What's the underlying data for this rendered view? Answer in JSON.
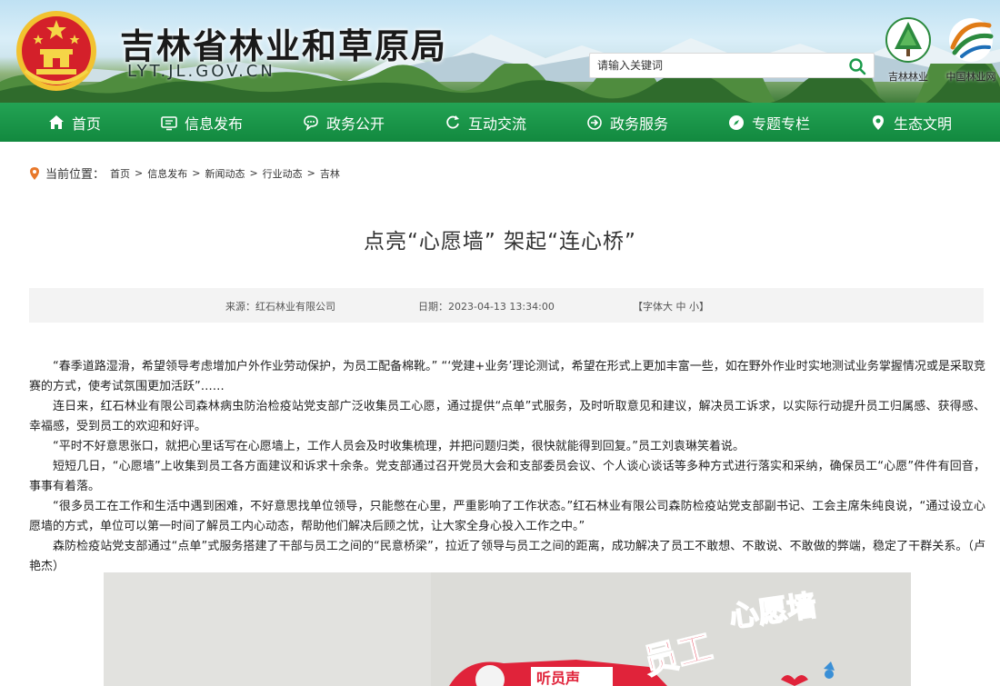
{
  "header": {
    "title": "吉林省林业和草原局",
    "domain": "LYT.JL.GOV.CN",
    "search_placeholder": "请输入关键词",
    "logo1_label": "吉林林业",
    "logo2_label": "中国林业网"
  },
  "nav": {
    "items": [
      {
        "label": "首页",
        "icon": "home-icon"
      },
      {
        "label": "信息发布",
        "icon": "screen-icon"
      },
      {
        "label": "政务公开",
        "icon": "chat-icon"
      },
      {
        "label": "互动交流",
        "icon": "refresh-icon"
      },
      {
        "label": "政务服务",
        "icon": "arrow-circle-icon"
      },
      {
        "label": "专题专栏",
        "icon": "compass-icon"
      },
      {
        "label": "生态文明",
        "icon": "location-icon"
      }
    ]
  },
  "breadcrumb": {
    "label": "当前位置：",
    "items": [
      "首页",
      "信息发布",
      "新闻动态",
      "行业动态",
      "吉林"
    ],
    "separator": ">"
  },
  "article": {
    "title": "点亮“心愿墙” 架起“连心桥”",
    "source_label": "来源：",
    "source": "红石林业有限公司",
    "date_label": "日期：",
    "date": "2023-04-13 13:34:00",
    "font_label": "【字体",
    "font_large": "大",
    "font_medium": "中",
    "font_small": "小",
    "font_close": "】",
    "paragraphs": [
      "“春季道路湿滑，希望领导考虑增加户外作业劳动保护，为员工配备棉靴。” “‘党建+业务’理论测试，希望在形式上更加丰富一些，如在野外作业时实地测试业务掌握情况或是采取竞赛的方式，使考试氛围更加活跃”……",
      "连日来，红石林业有限公司森林病虫防治检疫站党支部广泛收集员工心愿，通过提供“点单”式服务，及时听取意见和建议，解决员工诉求，以实际行动提升员工归属感、获得感、幸福感，受到员工的欢迎和好评。",
      "“平时不好意思张口，就把心里话写在心愿墙上，工作人员会及时收集梳理，并把问题归类，很快就能得到回复。”员工刘袁琳笑着说。",
      "短短几日，“心愿墙”上收集到员工各方面建议和诉求十余条。党支部通过召开党员大会和支部委员会议、个人谈心谈话等多种方式进行落实和采纳，确保员工“心愿”件件有回音，事事有着落。",
      "“很多员工在工作和生活中遇到困难，不好意思找单位领导，只能憋在心里，严重影响了工作状态。”红石林业有限公司森防检疫站党支部副书记、工会主席朱纯良说，“通过设立心愿墙的方式，单位可以第一时间了解员工内心动态，帮助他们解决后顾之忧，让大家全身心投入工作之中。”",
      "森防检疫站党支部通过“点单”式服务搭建了干部与员工之间的“民意桥梁”，拉近了领导与员工之间的距离，成功解决了员工不敢想、不敢说、不敢做的弊端，稳定了干群关系。（卢艳杰）"
    ]
  },
  "photo": {
    "sign_title": "心愿墙",
    "sign_prefix": "员工",
    "board_text": "听员声"
  },
  "colors": {
    "nav_green": "#1a9a4a",
    "sign_red": "#e0233a"
  }
}
